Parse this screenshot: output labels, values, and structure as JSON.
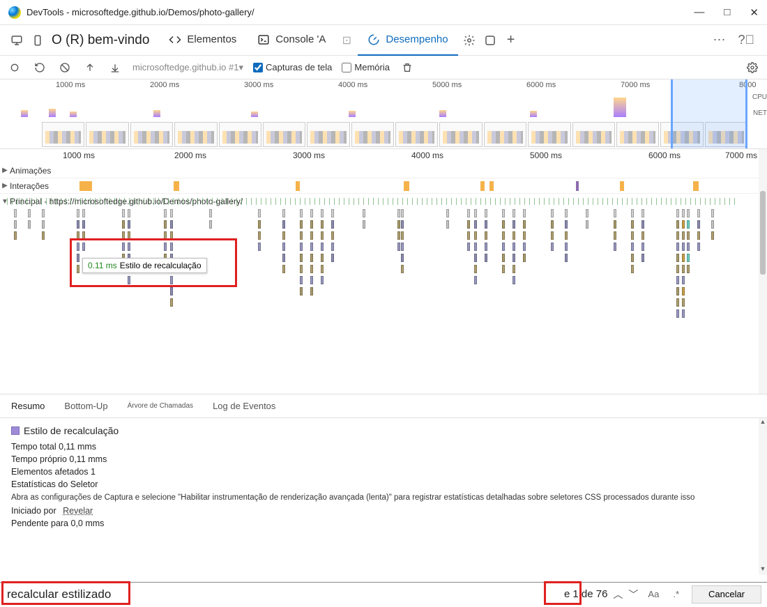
{
  "window": {
    "title": "DevTools - microsoftedge.github.io/Demos/photo-gallery/"
  },
  "tabbar": {
    "welcome": "O (R) bem-vindo",
    "elements": "Elementos",
    "console": "Console 'A",
    "performance": "Desempenho"
  },
  "toolbar": {
    "url": "microsoftedge.github.io #1▾",
    "screenshots": "Capturas de tela",
    "memory": "Memória"
  },
  "overview": {
    "ticks": [
      "1000 ms",
      "2000 ms",
      "3000 ms",
      "4000 ms",
      "5000 ms",
      "6000 ms",
      "7000 ms",
      "8000"
    ],
    "cpu": "CPU",
    "net": "NET"
  },
  "flame": {
    "ticks": [
      "1000 ms",
      "2000 ms",
      "3000 ms",
      "4000 ms",
      "5000 ms",
      "6000 ms",
      "7000 ms"
    ],
    "animations": "Animações",
    "interactions": "Interações",
    "main": "Principal - https://microsoftedge.github.io/Demos/photo-gallery/"
  },
  "tooltip": {
    "duration": "0.11 ms",
    "label": "Estilo de recalculação"
  },
  "detail_tabs": {
    "summary": "Resumo",
    "bottomup": "Bottom-Up",
    "calltree": "Árvore de Chamadas",
    "events": "Log de Eventos"
  },
  "summary": {
    "title": "Estilo de recalculação",
    "total": "Tempo total 0,11 mms",
    "self": "Tempo próprio 0,11 mms",
    "affected": "Elementos afetados 1",
    "selector_stats": "Estatísticas do Seletor",
    "note": "Abra as configurações de Captura e selecione \"Habilitar instrumentação de renderização avançada (lenta)\" para registrar estatísticas detalhadas sobre seletores CSS processados durante isso",
    "initiated_by": "Iniciado por",
    "reveal": "Revelar",
    "pending": "Pendente para 0,0 mms"
  },
  "search": {
    "query": "recalcular estilizado",
    "prefix": "e ",
    "count": "1 de 76",
    "aa": "Aa",
    "regex": ".*",
    "cancel": "Cancelar"
  }
}
